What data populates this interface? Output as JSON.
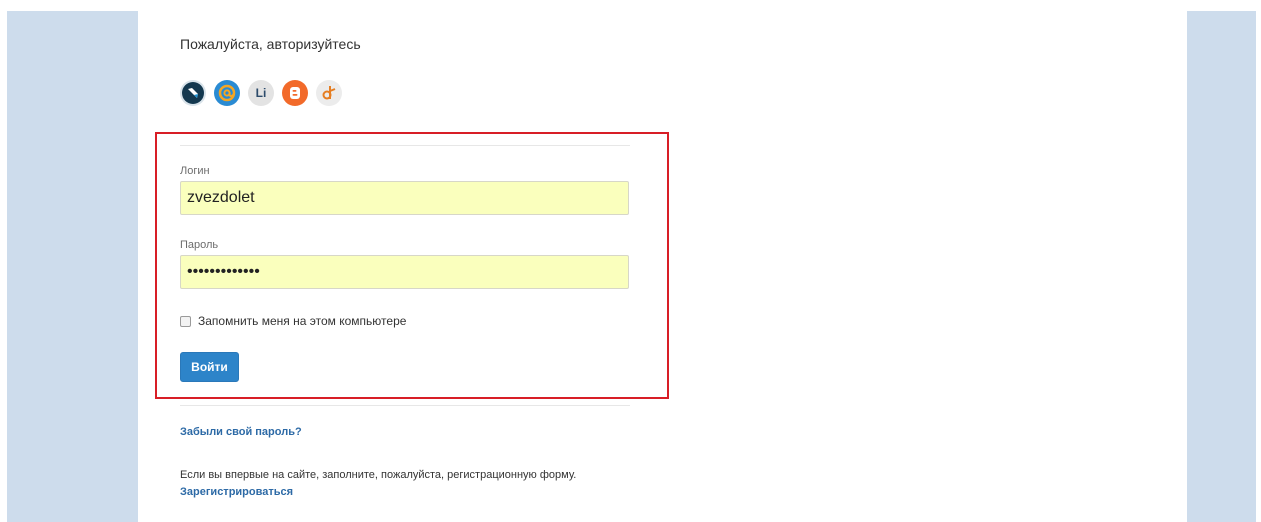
{
  "page": {
    "title": "Пожалуйста, авторизуйтесь"
  },
  "social_icons": [
    "livejournal-icon",
    "mail-icon",
    "liveinternet-icon",
    "blogger-icon",
    "odnoklassniki-icon"
  ],
  "social_li_label": "Li",
  "form": {
    "login_label": "Логин",
    "login_value": "zvezdolet",
    "password_label": "Пароль",
    "password_value": "•••••••••••••",
    "remember_label": "Запомнить меня на этом компьютере",
    "submit_label": "Войти"
  },
  "links": {
    "forgot": "Забыли свой пароль?",
    "register_note": "Если вы впервые на сайте, заполните, пожалуйста, регистрационную форму.",
    "register": "Зарегистрироваться"
  },
  "colors": {
    "side_panel": "#cddcec",
    "highlight_border": "#d81e26",
    "autofill": "#faffbd",
    "button": "#2d84c9",
    "link": "#2d6aa6"
  }
}
